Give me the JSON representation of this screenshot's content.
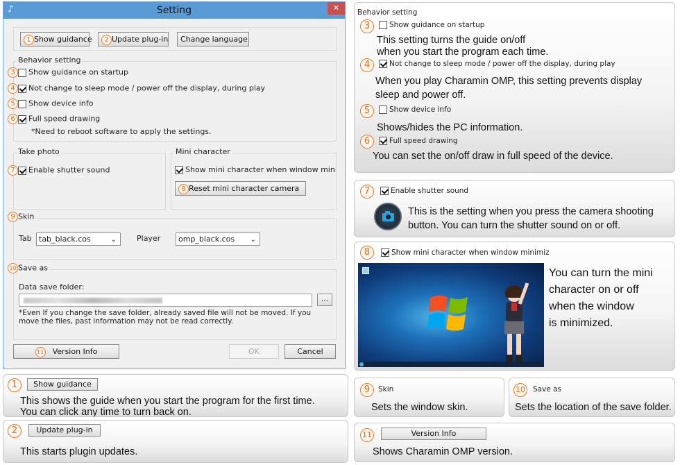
{
  "dialog": {
    "title": "Setting",
    "close_symbol": "✕",
    "top_buttons": [
      {
        "num": "1",
        "label": "Show guidance"
      },
      {
        "num": "2",
        "label": "Update plug-in"
      },
      {
        "label": "Change language"
      }
    ],
    "behavior": {
      "title": "Behavior setting",
      "items": [
        {
          "num": "3",
          "label": "Show guidance on startup",
          "checked": false
        },
        {
          "num": "4",
          "label": "Not change to sleep mode /  power off the display, during play",
          "checked": true
        },
        {
          "num": "5",
          "label": "Show device info",
          "checked": false
        },
        {
          "num": "6",
          "label": "Full speed drawing",
          "checked": true
        }
      ],
      "note": "*Need to reboot software to apply the settings."
    },
    "take_photo": {
      "title": "Take photo",
      "num": "7",
      "label": "Enable shutter sound",
      "checked": true
    },
    "mini_character": {
      "title": "Mini character",
      "label": "Show mini character when window minimiz",
      "checked": true,
      "reset_num": "8",
      "reset_label": "Reset mini character camera"
    },
    "skin": {
      "num": "9",
      "title": "Skin",
      "tab_label": "Tab",
      "tab_value": "tab_black.cos",
      "player_label": "Player",
      "player_value": "omp_black.cos"
    },
    "save_as": {
      "num": "10",
      "title": "Save as",
      "folder_label": "Data save folder:",
      "browse_label": "...",
      "note": "*Even If you change the save folder, already saved file will not be moved. If you move the files, past information may not be read correctly."
    },
    "version": {
      "num": "11",
      "label": "Version Info"
    },
    "ok_label": "OK",
    "cancel_label": "Cancel"
  },
  "explain": {
    "behavior": {
      "title": "Behavior setting",
      "items": [
        {
          "num": "3",
          "label": "Show guidance on startup",
          "checked": false,
          "desc1": "This setting turns the guide on/off",
          "desc2": "when you start the program each time."
        },
        {
          "num": "4",
          "label": "Not change to sleep mode /  power off the display, during play",
          "checked": true,
          "desc1": "When you play Charamin OMP, this setting prevents display",
          "desc2": "sleep and power off."
        },
        {
          "num": "5",
          "label": "Show device info",
          "checked": false,
          "desc1": "Shows/hides the PC information."
        },
        {
          "num": "6",
          "label": "Full speed drawing",
          "checked": true,
          "desc1": "You can set the on/off draw in full speed of the device."
        }
      ]
    },
    "shutter": {
      "num": "7",
      "label": "Enable shutter sound",
      "desc1": "This is the setting when you press the camera shooting",
      "desc2": "button. You can turn the shutter sound on or off."
    },
    "mini": {
      "num": "8",
      "label": "Show mini character when window minimiz",
      "desc": [
        "You can turn the mini",
        "character on or off",
        "when the window",
        "is minimized."
      ]
    },
    "guidance": {
      "num": "1",
      "label": "Show guidance",
      "desc1": "This shows the guide when you start the program for the first time.",
      "desc2": "You can click any time to turn back on."
    },
    "plugin": {
      "num": "2",
      "label": "Update plug-in",
      "desc1": "This starts plugin updates."
    },
    "skin": {
      "num": "9",
      "label": "Skin",
      "desc1": "Sets the window skin."
    },
    "saveas": {
      "num": "10",
      "label": "Save as",
      "desc1": "Sets the location of the save folder."
    },
    "version": {
      "num": "11",
      "label": "Version Info",
      "desc1": "Shows Charamin OMP version."
    }
  },
  "colors": {
    "titlebar": "#5b9bd5",
    "close": "#c75050",
    "accent": "#e06a16"
  }
}
